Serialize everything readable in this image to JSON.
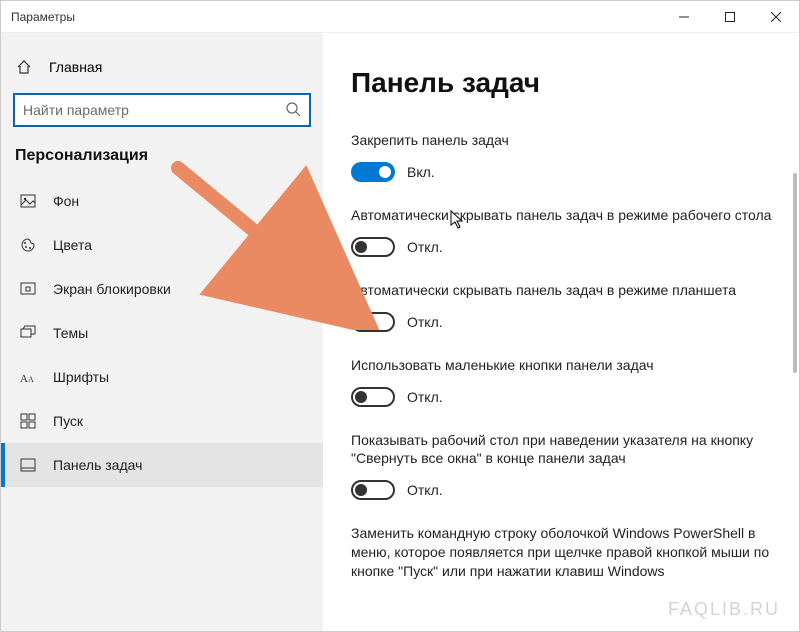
{
  "window": {
    "title": "Параметры"
  },
  "sidebar": {
    "home_label": "Главная",
    "search_placeholder": "Найти параметр",
    "section_title": "Персонализация",
    "items": [
      {
        "label": "Фон"
      },
      {
        "label": "Цвета"
      },
      {
        "label": "Экран блокировки"
      },
      {
        "label": "Темы"
      },
      {
        "label": "Шрифты"
      },
      {
        "label": "Пуск"
      },
      {
        "label": "Панель задач"
      }
    ]
  },
  "content": {
    "heading": "Панель задач",
    "toggle_on_label": "Вкл.",
    "toggle_off_label": "Откл.",
    "settings": [
      {
        "label": "Закрепить панель задач",
        "state": "on"
      },
      {
        "label": "Автоматически скрывать панель задач в режиме рабочего стола",
        "state": "off"
      },
      {
        "label": "Автоматически скрывать панель задач в режиме планшета",
        "state": "off"
      },
      {
        "label": "Использовать маленькие кнопки панели задач",
        "state": "off"
      },
      {
        "label": "Показывать рабочий стол при наведении указателя на кнопку \"Свернуть все окна\" в конце панели задач",
        "state": "off"
      }
    ],
    "partial_next": "Заменить командную строку оболочкой Windows PowerShell в меню, которое появляется при щелчке правой кнопкой мыши по кнопке \"Пуск\" или при нажатии клавиш Windows"
  },
  "watermark": "FAQLIB.RU",
  "colors": {
    "accent": "#0078d4",
    "arrow": "#e98a63"
  }
}
